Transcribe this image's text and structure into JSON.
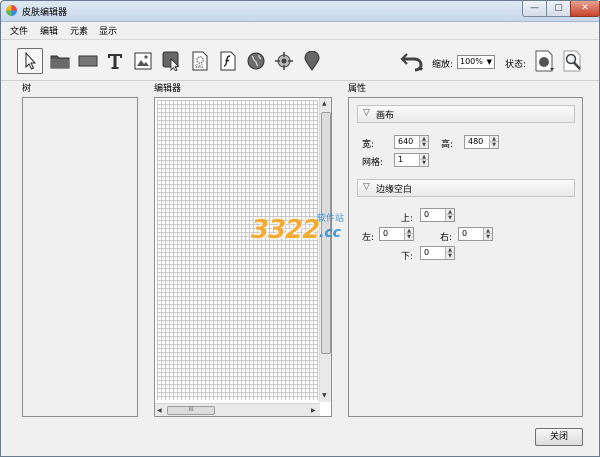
{
  "window": {
    "title": "皮肤编辑器"
  },
  "title_buttons": {
    "minimize": "—",
    "maximize": "▢",
    "close": "✕"
  },
  "menu": {
    "items": [
      "文件",
      "编辑",
      "元素",
      "显示"
    ]
  },
  "toolbar": {
    "tools": [
      "pointer-icon",
      "folder-icon",
      "rectangle-icon",
      "text-icon",
      "image-icon",
      "cursor-button-icon",
      "svg-file-icon",
      "flash-icon",
      "globe-icon",
      "crosshair-icon",
      "map-pin-icon"
    ],
    "undo_icon": "undo-icon",
    "zoom_label": "缩放:",
    "zoom_value": "100%",
    "state_label": "状态:",
    "state_icon": "state-dot-icon",
    "search_icon": "magnifier-icon"
  },
  "panels": {
    "tree_title": "树",
    "editor_title": "编辑器",
    "props_title": "属性"
  },
  "scroll": {
    "grip": "III",
    "up": "▲",
    "down": "▼",
    "left": "◀",
    "right": "▶"
  },
  "canvas_section": {
    "title": "画布",
    "width_label": "宽:",
    "width_value": "640",
    "height_label": "高:",
    "height_value": "480",
    "grid_label": "网格:",
    "grid_value": "1"
  },
  "margin_section": {
    "title": "边缘空白",
    "top_label": "上:",
    "top_value": "0",
    "left_label": "左:",
    "left_value": "0",
    "right_label": "右:",
    "right_value": "0",
    "bottom_label": "下:",
    "bottom_value": "0"
  },
  "spin": {
    "up": "▲",
    "down": "▼"
  },
  "watermark": {
    "number": "3322",
    "suffix": ".cc",
    "site": "软件站"
  },
  "footer": {
    "close_label": "关闭"
  },
  "colors": {
    "accent_orange": "#f5a623",
    "accent_blue": "#2a8fd6",
    "close_red": "#c8432e"
  }
}
